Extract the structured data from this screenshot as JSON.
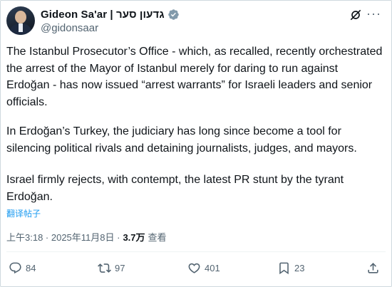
{
  "author": {
    "display_name": "Gideon Sa'ar | גדעון סער",
    "handle": "@gidonsaar"
  },
  "tweet": {
    "paragraphs": [
      "The Istanbul Prosecutor’s Office - which, as recalled, recently orchestrated the arrest of the Mayor of Istanbul merely for daring to run against Erdoğan - has now issued “arrest warrants” for Israeli leaders and senior officials.",
      "In Erdoğan’s Turkey, the judiciary has long since become a tool for silencing political rivals and detaining journalists, judges, and mayors.",
      "Israel firmly rejects, with contempt, the latest PR stunt by the tyrant Erdoğan."
    ],
    "translate_label": "翻译帖子"
  },
  "meta": {
    "time": "上午3:18 · 2025年11月8日 ·",
    "views_count": "3.7万",
    "views_label": "查看"
  },
  "actions": {
    "replies": "84",
    "reposts": "97",
    "likes": "401",
    "bookmarks": "23"
  },
  "icons": [
    "verified-badge-icon",
    "grok-icon",
    "more-icon",
    "reply-icon",
    "repost-icon",
    "like-icon",
    "bookmark-icon",
    "share-icon"
  ],
  "colors": {
    "accent": "#1d9bf0",
    "secondary_text": "#536471",
    "badge": "#829aab"
  }
}
